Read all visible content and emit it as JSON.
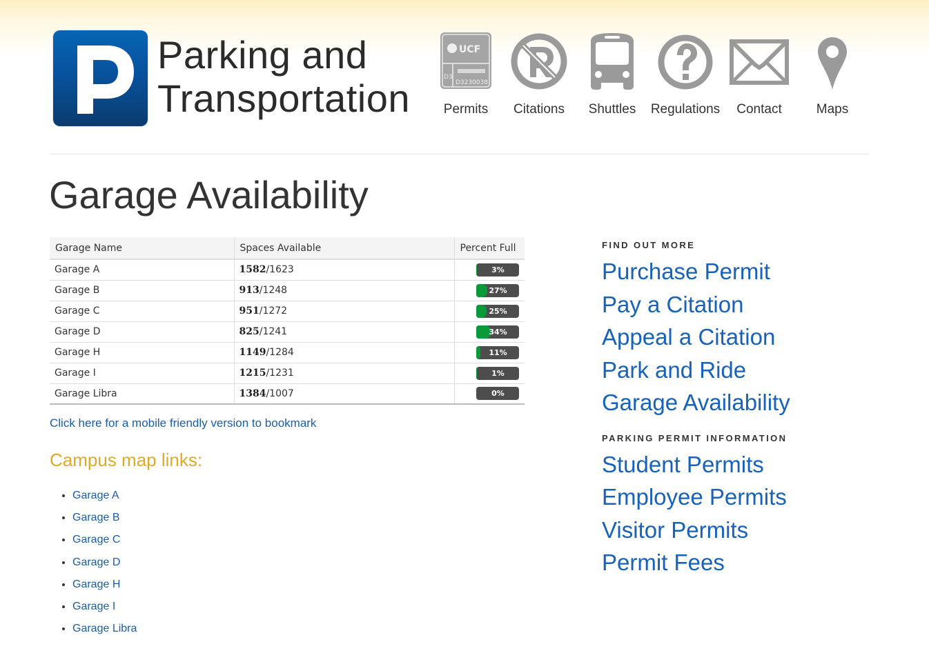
{
  "header": {
    "brand_line1": "Parking and",
    "brand_line2": "Transportation",
    "logo_letter": "P",
    "nav": [
      {
        "label": "Permits",
        "icon": "permit-tag-icon"
      },
      {
        "label": "Citations",
        "icon": "no-parking-icon"
      },
      {
        "label": "Shuttles",
        "icon": "bus-icon"
      },
      {
        "label": "Regulations",
        "icon": "question-circle-icon"
      },
      {
        "label": "Contact",
        "icon": "envelope-icon"
      },
      {
        "label": "Maps",
        "icon": "map-pin-icon"
      }
    ],
    "permit_icon_text": {
      "brand": "UCF",
      "code": "D3",
      "serial": "D3230038"
    }
  },
  "page_title": "Garage Availability",
  "table": {
    "headers": [
      "Garage Name",
      "Spaces Available",
      "Percent Full"
    ],
    "rows": [
      {
        "name": "Garage A",
        "available": "1582",
        "total": "/1623",
        "percent_full": 3,
        "percent_label": "3%"
      },
      {
        "name": "Garage B",
        "available": "913",
        "total": "/1248",
        "percent_full": 27,
        "percent_label": "27%"
      },
      {
        "name": "Garage C",
        "available": "951",
        "total": "/1272",
        "percent_full": 25,
        "percent_label": "25%"
      },
      {
        "name": "Garage D",
        "available": "825",
        "total": "/1241",
        "percent_full": 34,
        "percent_label": "34%"
      },
      {
        "name": "Garage H",
        "available": "1149",
        "total": "/1284",
        "percent_full": 11,
        "percent_label": "11%"
      },
      {
        "name": "Garage I",
        "available": "1215",
        "total": "/1231",
        "percent_full": 1,
        "percent_label": "1%"
      },
      {
        "name": "Garage Libra",
        "available": "1384",
        "total": "/1007",
        "percent_full": 0,
        "percent_label": "0%"
      }
    ]
  },
  "mobile_link": "Click here for a mobile friendly version to bookmark",
  "campus_map": {
    "heading": "Campus map links:",
    "links": [
      "Garage A",
      "Garage B",
      "Garage C",
      "Garage D",
      "Garage H",
      "Garage I",
      "Garage Libra"
    ]
  },
  "sidebar": {
    "find_out_more": {
      "heading": "FIND OUT MORE",
      "links": [
        "Purchase Permit",
        "Pay a Citation",
        "Appeal a Citation",
        "Park and Ride",
        "Garage Availability"
      ]
    },
    "permit_info": {
      "heading": "PARKING PERMIT INFORMATION",
      "links": [
        "Student Permits",
        "Employee Permits",
        "Visitor Permits",
        "Permit Fees"
      ]
    }
  },
  "colors": {
    "link": "#1762ba",
    "heading_gold": "#e0aa22",
    "bar_fill": "#0a9a3a",
    "bar_track": "#4d4d4d",
    "icon_gray": "#9a9a9a",
    "logo_blue": "#08509a"
  }
}
